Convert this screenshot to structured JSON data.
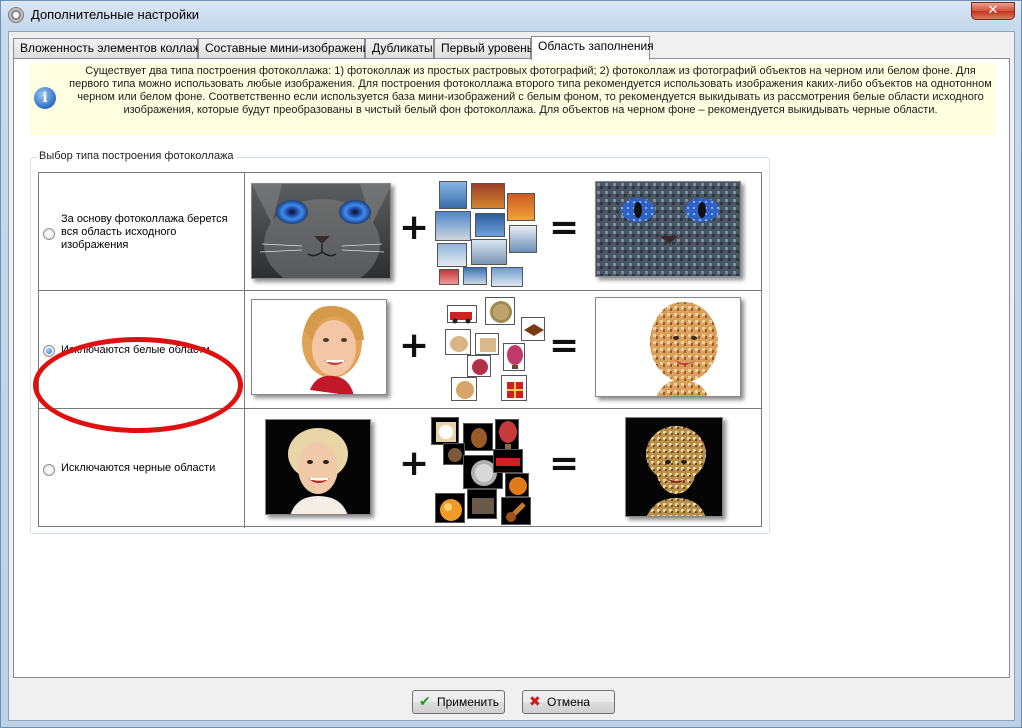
{
  "window": {
    "title": "Дополнительные настройки",
    "close_glyph": "✕"
  },
  "tabs": [
    {
      "label": "Вложенность элементов коллажа",
      "active": false
    },
    {
      "label": "Составные мини-изображения",
      "active": false
    },
    {
      "label": "Дубликаты",
      "active": false
    },
    {
      "label": "Первый уровень",
      "active": false
    },
    {
      "label": "Область заполнения",
      "active": true
    }
  ],
  "info": {
    "icon_glyph": "i",
    "text": "Существует два типа построения фотоколлажа: 1) фотоколлаж из простых растровых фотографий; 2) фотоколлаж из фотографий объектов на черном или белом фоне. Для первого типа можно использовать любые изображения. Для построения фотоколлажа второго типа рекомендуется использовать изображения каких-либо объектов на однотонном черном или белом фоне. Соответственно если используется база мини-изображений с белым фоном, то рекомендуется выкидывать из рассмотрения белые области исходного изображения, которые будут преобразованы в чистый белый фон фотоколлажа. Для объектов на черном фоне – рекомендуется выкидывать черные области."
  },
  "group": {
    "legend": "Выбор типа построения фотоколлажа",
    "options": [
      {
        "label": "За основу фотоколлажа берется вся область исходного изображения",
        "checked": false
      },
      {
        "label": "Исключаются белые области",
        "checked": true
      },
      {
        "label": "Исключаются черные области",
        "checked": false
      }
    ],
    "plus": "+",
    "equals": "="
  },
  "buttons": {
    "apply": "Применить",
    "cancel": "Отмена",
    "apply_icon": "✔",
    "cancel_icon": "✖"
  },
  "colors": {
    "highlight_ellipse": "#e01010",
    "info_background": "#ffffe1"
  }
}
